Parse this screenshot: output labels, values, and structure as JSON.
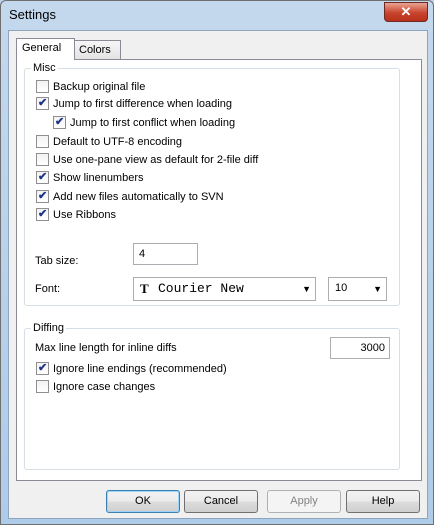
{
  "window": {
    "title": "Settings",
    "close_glyph": "✕"
  },
  "tabs": [
    {
      "label": "General",
      "active": true
    },
    {
      "label": "Colors",
      "active": false
    }
  ],
  "misc": {
    "group_label": "Misc",
    "checkboxes": [
      {
        "label": "Backup original file",
        "checked": false
      },
      {
        "label": "Jump to first difference when loading",
        "checked": true
      },
      {
        "label": "Jump to first conflict when loading",
        "checked": true
      },
      {
        "label": "Default to UTF-8 encoding",
        "checked": false
      },
      {
        "label": "Use one-pane view as default for 2-file diff",
        "checked": false
      },
      {
        "label": "Show linenumbers",
        "checked": true
      },
      {
        "label": "Add new files automatically to SVN",
        "checked": true
      },
      {
        "label": "Use Ribbons",
        "checked": true
      }
    ],
    "tab_size_label": "Tab size:",
    "tab_size_value": "4",
    "font_label": "Font:",
    "font_value": "Courier New",
    "font_icon": "truetype-font-icon",
    "font_size_value": "10"
  },
  "diffing": {
    "group_label": "Diffing",
    "max_line_label": "Max line length for inline diffs",
    "max_line_value": "3000",
    "checkboxes": [
      {
        "label": "Ignore line endings (recommended)",
        "checked": true
      },
      {
        "label": "Ignore case changes",
        "checked": false
      }
    ]
  },
  "buttons": {
    "ok": "OK",
    "cancel": "Cancel",
    "apply": "Apply",
    "help": "Help"
  },
  "check_glyph": "✔",
  "arrow_glyph": "▼",
  "colors": {
    "title_bg": "#b9d1ea",
    "close_red": "#c8432c",
    "panel": "#f0f0f0"
  }
}
